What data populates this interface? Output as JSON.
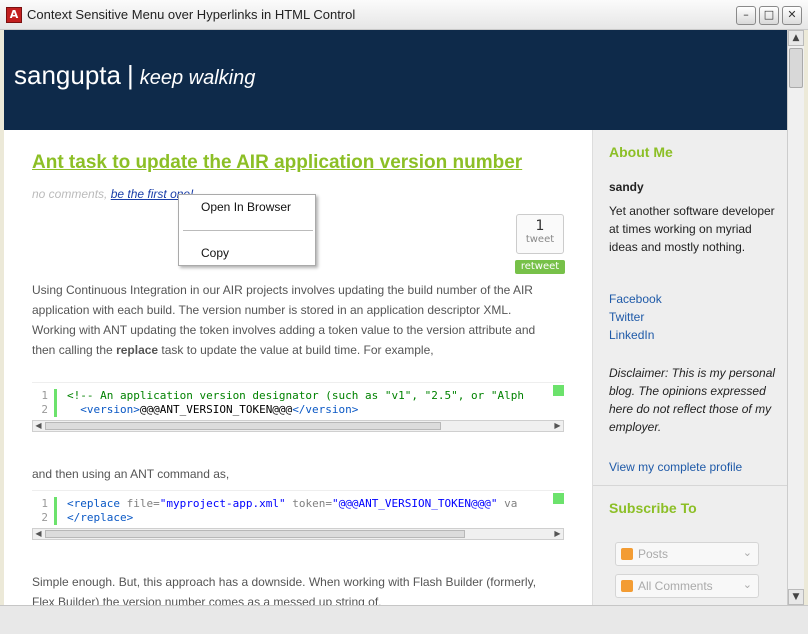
{
  "window": {
    "title": "Context Sensitive Menu over Hyperlinks in HTML Control",
    "min": "–",
    "max": "□",
    "close": "✕",
    "app_icon": "A"
  },
  "header": {
    "brand": "sangupta",
    "separator": "|",
    "tagline": "keep walking"
  },
  "post": {
    "title": "Ant task to update the AIR application version number",
    "meta_comments": "no comments,",
    "meta_link": "be the first one!",
    "tweet_count": "1",
    "tweet_label": "tweet",
    "retweet_label": "retweet",
    "p1_a": "Using Continuous Integration in our AIR projects involves updating the build number of the AIR application with each build. The version number is stored in an application descriptor XML. Working with ANT updating the token involves adding a token value to the version attribute and then calling the ",
    "p1_bold": "replace",
    "p1_b": " task to update the value at build time. For example,",
    "p2": "and then using an ANT command as,",
    "p3": "Simple enough. But, this approach has a downside. When working with Flash Builder (formerly, Flex Builder) the version number comes as a messed up string of,"
  },
  "code1": {
    "ln1": "1",
    "ln2": "2",
    "line1": "<!-- An application version designator (such as \"v1\", \"2.5\", or \"Alph",
    "line2_open": "<version>",
    "line2_val": "@@@ANT_VERSION_TOKEN@@@",
    "line2_close": "</version>"
  },
  "code2": {
    "ln1": "1",
    "ln2": "2",
    "line1_tag": "<replace",
    "line1_attr1": "file=",
    "line1_val1": "\"myproject-app.xml\"",
    "line1_attr2": "token=",
    "line1_val2": "\"@@@ANT_VERSION_TOKEN@@@\"",
    "line1_tail": "va",
    "line2": "</replace>"
  },
  "sidebar": {
    "about_heading": "About Me",
    "name": "sandy",
    "bio": "Yet another software developer at times working on myriad ideas and mostly nothing.",
    "links": [
      "Facebook",
      "Twitter",
      "LinkedIn"
    ],
    "disclaimer": "Disclaimer: This is my personal blog. The opinions expressed here do not reflect those of my employer.",
    "profile_link": "View my complete profile",
    "subscribe_heading": "Subscribe To",
    "sub_posts": "Posts",
    "sub_comments": "All Comments"
  },
  "context_menu": {
    "open": "Open In Browser",
    "copy": "Copy"
  },
  "colors": {
    "header_bg": "#0e2a4a",
    "accent_green": "#8cbf26",
    "link_blue": "#1f5aa8"
  }
}
